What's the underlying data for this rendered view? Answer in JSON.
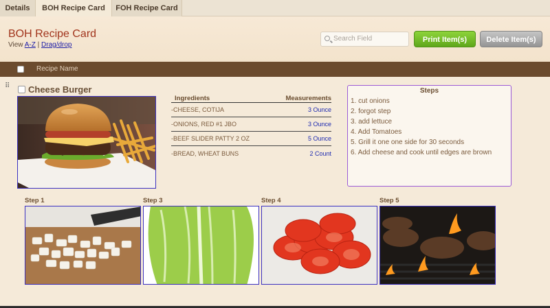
{
  "tabs": [
    {
      "label": "Details"
    },
    {
      "label": "BOH Recipe Card"
    },
    {
      "label": "FOH Recipe Card"
    }
  ],
  "header": {
    "title": "BOH Recipe Card",
    "view_prefix": "View",
    "view_az": "A-Z",
    "view_sep": "|",
    "view_drag": "Drag/drop",
    "search_placeholder": "Search Field",
    "print_label": "Print Item(s)",
    "delete_label": "Delete Item(s)"
  },
  "columns": {
    "recipe_name": "Recipe Name"
  },
  "recipe": {
    "drag_glyph": "⠿",
    "name": "Cheese Burger",
    "ingredients_header": "Ingredients",
    "measurements_header": "Measurements",
    "ingredients": [
      {
        "name": "-CHEESE, COTIJA",
        "amount": "3 Ounce"
      },
      {
        "name": "-ONIONS, RED #1 JBO",
        "amount": "3 Ounce"
      },
      {
        "name": "-BEEF SLIDER PATTY 2 OZ",
        "amount": "5 Ounce"
      },
      {
        "name": "-BREAD, WHEAT BUNS",
        "amount": "2 Count"
      }
    ],
    "steps_title": "Steps",
    "steps": [
      "1.  cut onions",
      "2.  forgot step",
      "3.  add lettuce",
      "4.  Add Tomatoes",
      "5.  Grill it one one side for 30 seconds",
      "6.  Add cheese and cook until edges are brown"
    ],
    "step_photos": [
      {
        "label": "Step 1"
      },
      {
        "label": "Step 3"
      },
      {
        "label": "Step 4"
      },
      {
        "label": "Step 5"
      }
    ]
  },
  "colors": {
    "title_red": "#a1341c",
    "header_bar": "#6b4b2e",
    "print_green": "#6bb81f",
    "delete_gray": "#a8a8a8",
    "link_blue": "#1a1aa6"
  }
}
